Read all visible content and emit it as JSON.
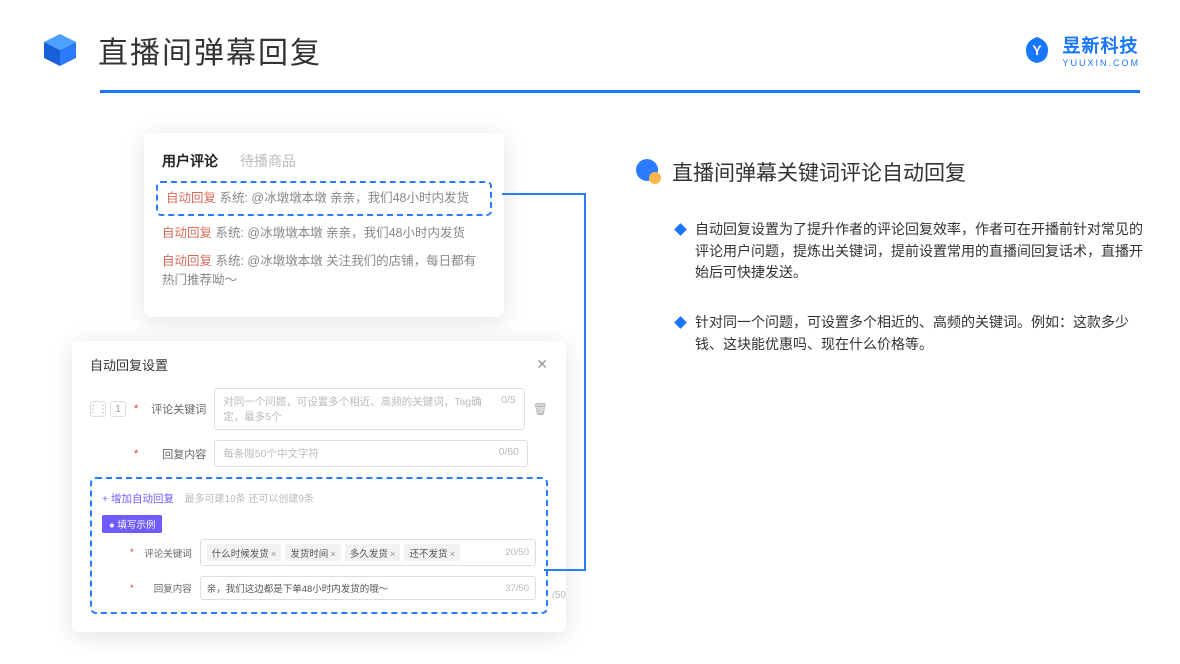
{
  "header": {
    "title": "直播间弹幕回复",
    "brand": "昱新科技",
    "brandSub": "YUUXIN.COM"
  },
  "commentCard": {
    "tabActive": "用户评论",
    "tabInactive": "待播商品",
    "r1": {
      "lbl": "自动回复",
      "txt": " 系统: @冰墩墩本墩 亲亲，我们48小时内发货"
    },
    "r2": {
      "lbl": "自动回复",
      "txt": " 系统: @冰墩墩本墩 亲亲，我们48小时内发货"
    },
    "r3": {
      "lbl": "自动回复",
      "txt": " 系统: @冰墩墩本墩 关注我们的店铺，每日都有热门推荐呦～"
    }
  },
  "modal": {
    "title": "自动回复设置",
    "idx": "1",
    "label1": "评论关键词",
    "ph1": "对同一个问题，可设置多个相近、高频的关键词，Tag确定，最多5个",
    "cnt1": "0/5",
    "label2": "回复内容",
    "ph2": "每条限50个中文字符",
    "cnt2": "0/50",
    "addlink": "+ 增加自动回复",
    "addhint": "最多可建10条 还可以创建9条",
    "badge": "● 填写示例",
    "ex_label1": "评论关键词",
    "tags": [
      "什么时候发货",
      "发货时间",
      "多久发货",
      "还不发货"
    ],
    "ex_cnt1": "20/50",
    "ex_label2": "回复内容",
    "ex_val": "亲，我们这边都是下单48小时内发货的哦～",
    "ex_cnt2": "37/50",
    "extra": "/50"
  },
  "right": {
    "sectionTitle": "直播间弹幕关键词评论自动回复",
    "b1": "自动回复设置为了提升作者的评论回复效率，作者可在开播前针对常见的评论用户问题，提炼出关键词，提前设置常用的直播间回复话术，直播开始后可快捷发送。",
    "b2": "针对同一个问题，可设置多个相近的、高频的关键词。例如：这款多少钱、这块能优惠吗、现在什么价格等。"
  }
}
